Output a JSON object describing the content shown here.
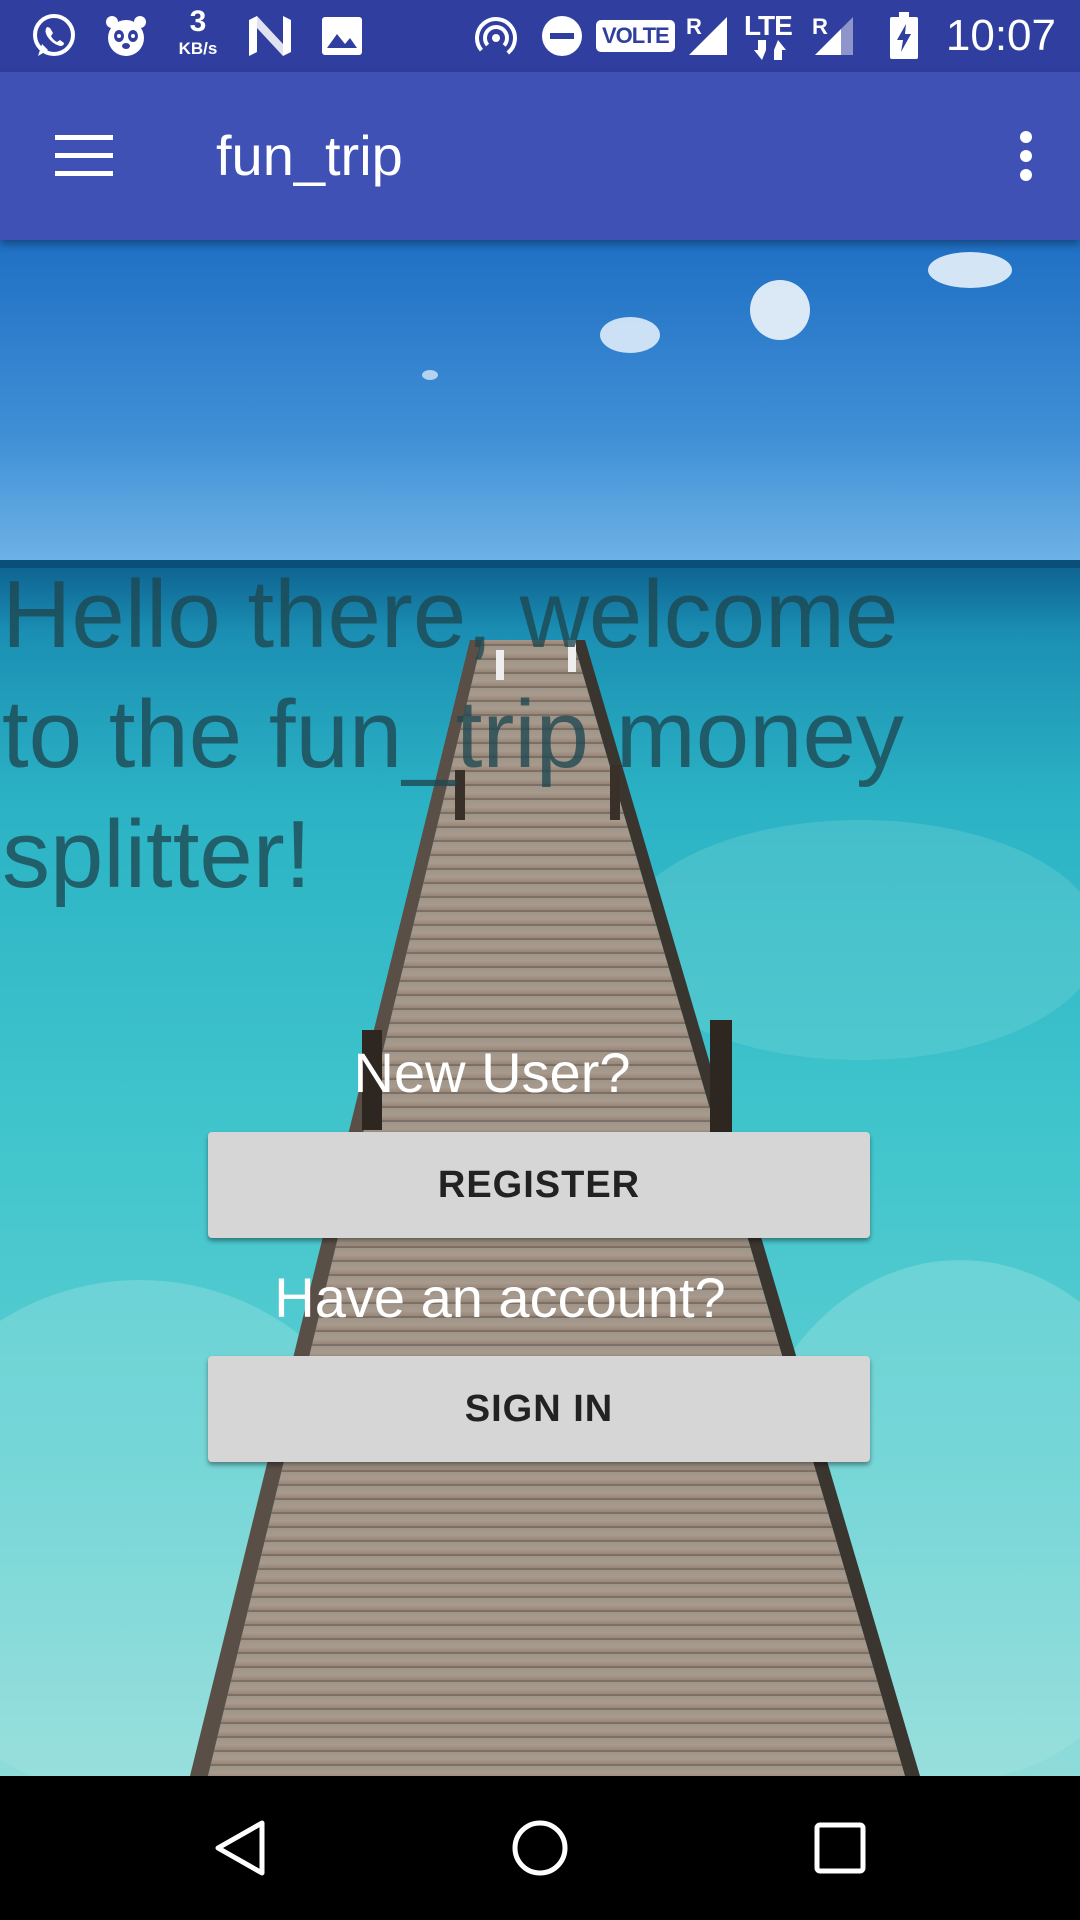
{
  "status_bar": {
    "data_speed_value": "3",
    "data_speed_unit": "KB/s",
    "volte_label": "VOLTE",
    "roaming_1": "R",
    "network_type": "LTE",
    "roaming_2": "R",
    "time": "10:07",
    "icons": [
      "whatsapp-icon",
      "foodpanda-icon",
      "n-icon",
      "image-icon",
      "hotspot-icon",
      "do-not-disturb-icon",
      "signal-icon",
      "battery-charging-icon"
    ]
  },
  "app_bar": {
    "title": "fun_trip",
    "menu_icon": "hamburger-menu-icon",
    "overflow_icon": "more-vert-icon",
    "color": "#3f51b5",
    "status_color": "#303f9f"
  },
  "main": {
    "welcome_text": "Hello there, welcome to the fun_trip money splitter!",
    "new_user_label": "New User?",
    "register_label": "REGISTER",
    "have_account_label": "Have an account?",
    "sign_in_label": "SIGN IN"
  },
  "nav_bar": {
    "icons": [
      "back-icon",
      "home-icon",
      "recents-icon"
    ]
  }
}
